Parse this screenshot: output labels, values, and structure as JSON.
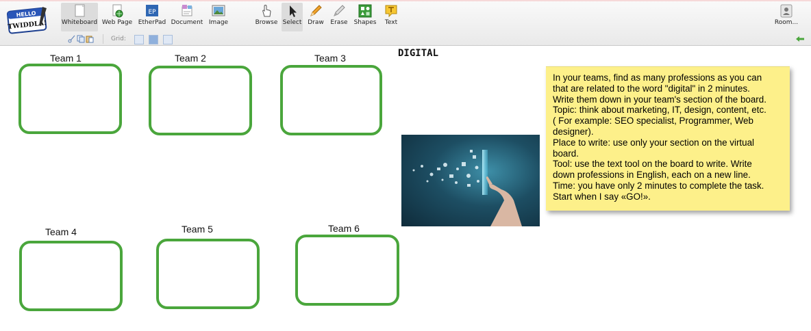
{
  "logo": {
    "text_top": "HELLO",
    "text_main": "TWIDDLA!"
  },
  "toolbar": {
    "tools": [
      {
        "label": "Whiteboard",
        "icon": "whiteboard-icon"
      },
      {
        "label": "Web Page",
        "icon": "web-page-icon"
      },
      {
        "label": "EtherPad",
        "icon": "etherpad-icon",
        "icon_text": "EP"
      },
      {
        "label": "Document",
        "icon": "document-icon"
      },
      {
        "label": "Image",
        "icon": "image-icon"
      },
      {
        "label": "Browse",
        "icon": "hand-icon"
      },
      {
        "label": "Select",
        "icon": "cursor-icon"
      },
      {
        "label": "Draw",
        "icon": "pencil-icon"
      },
      {
        "label": "Erase",
        "icon": "eraser-icon"
      },
      {
        "label": "Shapes",
        "icon": "shapes-icon"
      },
      {
        "label": "Text",
        "icon": "text-icon"
      }
    ],
    "room_label": "Room...",
    "grid_label": "Grid:"
  },
  "canvas": {
    "title": "DIGITAL",
    "teams": [
      {
        "label": "Team 1"
      },
      {
        "label": "Team 2"
      },
      {
        "label": "Team 3"
      },
      {
        "label": "Team 4"
      },
      {
        "label": "Team 5"
      },
      {
        "label": "Team 6"
      }
    ],
    "note_lines": [
      "In your teams, find as many professions as you can",
      "that are related to the word \"digital\" in 2 minutes.",
      "Write them down in your team's section of the board.",
      "Topic: think about marketing, IT, design, content, etc.",
      "( For example: SEO specialist, Programmer, Web",
      "designer).",
      "Place to write: use only your section on the virtual",
      "board.",
      "Tool: use the text tool on the board to write. Write",
      "down professions in English, each on a new line.",
      "Time: you have only 2 minutes to complete the task.",
      "Start when I say «GO!»."
    ],
    "colors": {
      "box_border": "#4aa63c",
      "note_bg": "#fdf08a"
    }
  }
}
